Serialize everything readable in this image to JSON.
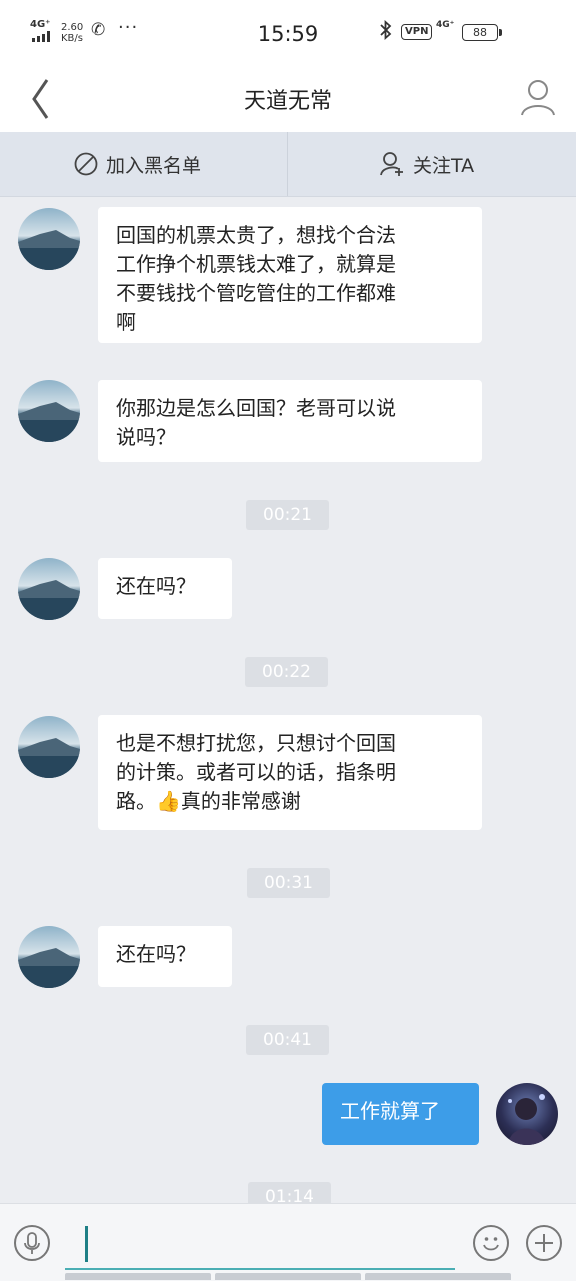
{
  "status_bar": {
    "network": "4G⁺",
    "speed_value": "2.60",
    "speed_unit": "KB/s",
    "more": "···",
    "time": "15:59",
    "vpn": "VPN",
    "network2": "4G⁺",
    "battery": "88"
  },
  "header": {
    "title": "天道无常",
    "back_icon": "chevron-left-icon",
    "profile_icon": "person-icon"
  },
  "actions": {
    "block_label": "加入黑名单",
    "block_icon": "ban-icon",
    "follow_label": "关注TA",
    "follow_icon": "person-add-icon"
  },
  "messages": [
    {
      "type": "in",
      "lines": [
        "回国的机票太贵了，想找个合法",
        "工作挣个机票钱太难了，就算是",
        "不要钱找个管吃管住的工作都难",
        "啊"
      ]
    },
    {
      "type": "in",
      "lines": [
        "你那边是怎么回国？老哥可以说",
        "说吗？"
      ]
    },
    {
      "type": "time",
      "text": "00:21"
    },
    {
      "type": "in",
      "lines": [
        "还在吗？"
      ]
    },
    {
      "type": "time",
      "text": "00:22"
    },
    {
      "type": "in",
      "lines": [
        "也是不想打扰您，只想讨个回国",
        "的计策。或者可以的话，指条明",
        "路。👍真的非常感谢"
      ]
    },
    {
      "type": "time",
      "text": "00:31"
    },
    {
      "type": "in",
      "lines": [
        "还在吗？"
      ]
    },
    {
      "type": "time",
      "text": "00:41"
    },
    {
      "type": "out",
      "lines": [
        "工作就算了"
      ]
    },
    {
      "type": "time",
      "text": "01:14"
    }
  ],
  "input_bar": {
    "voice_icon": "microphone-icon",
    "text": "",
    "emoji_icon": "smiley-icon",
    "plus_icon": "plus-icon"
  },
  "colors": {
    "background": "#ebedf1",
    "outgoing_bubble": "#3d9de8",
    "action_bar": "#dfe4ec",
    "input_accent": "#4aaeb4"
  }
}
